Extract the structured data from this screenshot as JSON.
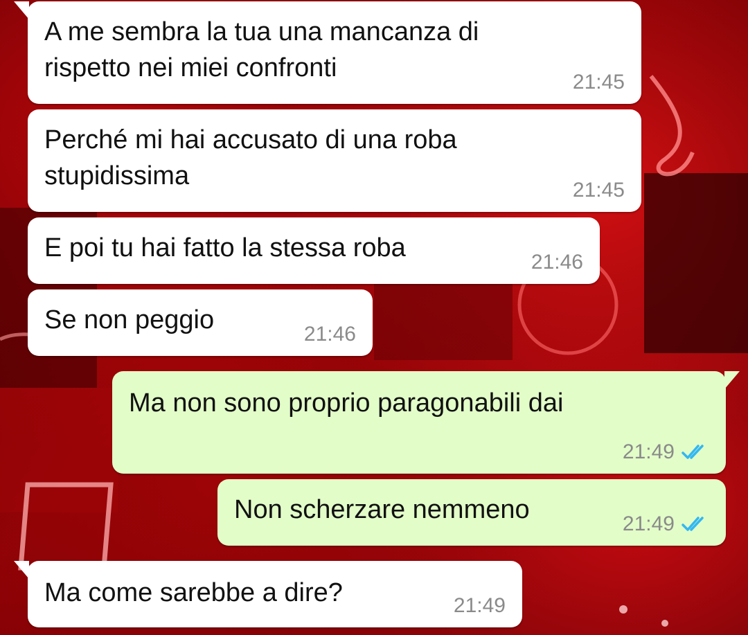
{
  "colors": {
    "incoming_bubble": "#ffffff",
    "outgoing_bubble": "#e2fdc8",
    "timestamp": "#8a8a8a",
    "read_ticks": "#34b7f1",
    "wallpaper": "#8a0205"
  },
  "messages": [
    {
      "direction": "incoming",
      "text": "A me sembra la tua una mancanza di\nrispetto nei miei confronti",
      "time": "21:45"
    },
    {
      "direction": "incoming",
      "text": "Perché mi hai accusato di una roba\nstupidissima",
      "time": "21:45"
    },
    {
      "direction": "incoming",
      "text": "E poi tu hai fatto la stessa roba",
      "time": "21:46"
    },
    {
      "direction": "incoming",
      "text": "Se non peggio",
      "time": "21:46"
    },
    {
      "direction": "outgoing",
      "text": "Ma non sono proprio paragonabili dai",
      "time": "21:49",
      "status_icon": "double-check-read-icon"
    },
    {
      "direction": "outgoing",
      "text": "Non scherzare nemmeno",
      "time": "21:49",
      "status_icon": "double-check-read-icon"
    },
    {
      "direction": "incoming",
      "text": "Ma come sarebbe a dire?",
      "time": "21:49"
    }
  ]
}
